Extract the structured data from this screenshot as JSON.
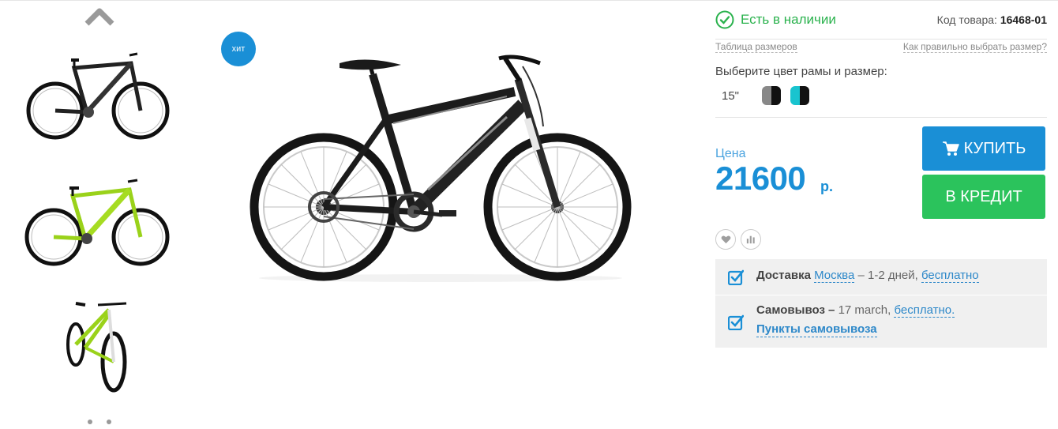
{
  "product": {
    "badge": "хит",
    "stock_status": "Есть в наличии",
    "sku_label": "Код товара:",
    "sku_value": "16468-01"
  },
  "links": {
    "size_table": "Таблица размеров",
    "size_help": "Как правильно выбрать размер?"
  },
  "options": {
    "prompt": "Выберите цвет рамы и размер:",
    "size": "15\"",
    "swatches": [
      {
        "name": "black-grey",
        "colors": [
          "#888888",
          "#111111"
        ]
      },
      {
        "name": "black-cyan",
        "colors": [
          "#19c4cf",
          "#111111"
        ]
      }
    ]
  },
  "price": {
    "label": "Цена",
    "value": "21600",
    "currency": "р."
  },
  "buttons": {
    "buy": "КУПИТЬ",
    "credit": "В КРЕДИТ"
  },
  "delivery": {
    "delivery_label": "Доставка",
    "delivery_city": "Москва",
    "delivery_terms": " – 1-2 дней, ",
    "delivery_free": "бесплатно",
    "pickup_label": "Самовывоз –",
    "pickup_date": " 17 march, ",
    "pickup_free": "бесплатно.",
    "pickup_points": "Пункты самовывоза"
  },
  "colors": {
    "accent_blue": "#1a8fd6",
    "green": "#2bc35c",
    "stock_green": "#2ab24d"
  },
  "icons": [
    "chevron-up-icon",
    "chevron-down-icon",
    "check-circle-icon",
    "cart-icon",
    "heart-icon",
    "compare-icon",
    "checkbox-checked-icon"
  ]
}
